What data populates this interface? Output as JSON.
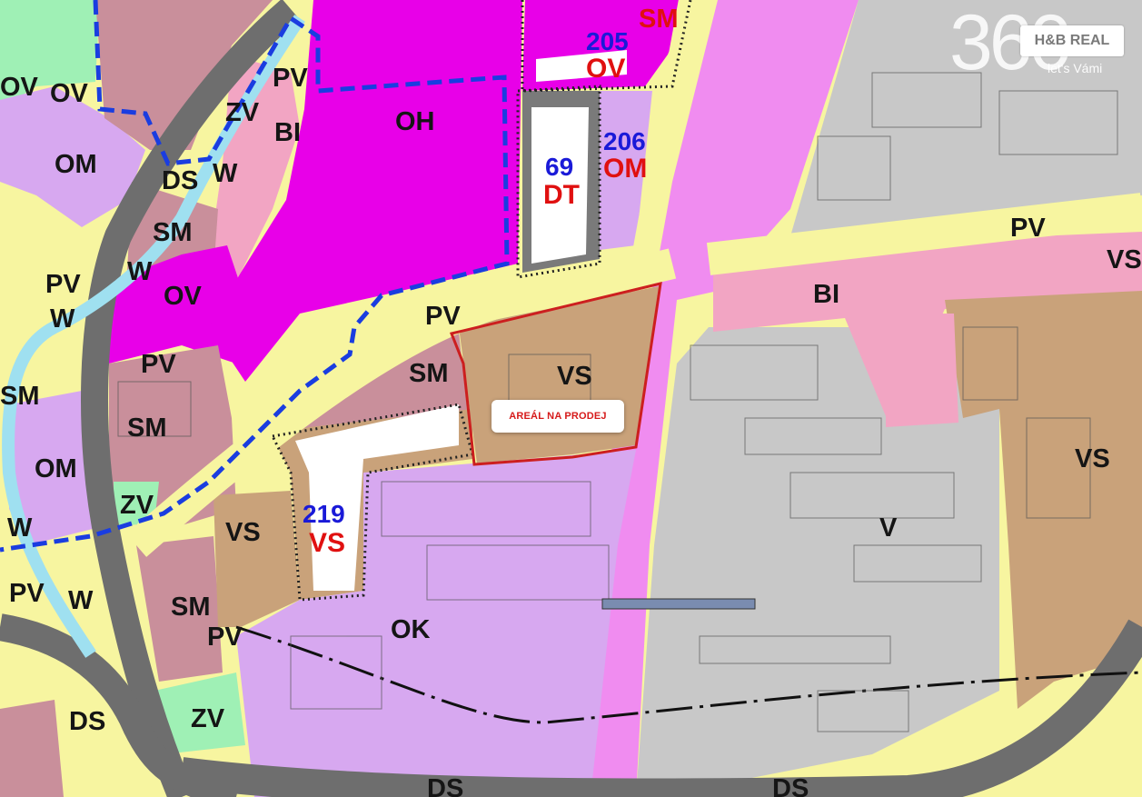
{
  "map": {
    "zones": [
      {
        "code": "OV",
        "color": "#e800e8"
      },
      {
        "code": "OH",
        "color": "#e800e8"
      },
      {
        "code": "OM",
        "color": "#d7a8f0"
      },
      {
        "code": "OK",
        "color": "#d7a8f0"
      },
      {
        "code": "SM",
        "color": "#c98f9b"
      },
      {
        "code": "BI",
        "color": "#f2a5c3"
      },
      {
        "code": "VS",
        "color": "#c9a27a"
      },
      {
        "code": "V",
        "color": "#c8c8c8"
      },
      {
        "code": "PV",
        "color": "#f7f5a0"
      },
      {
        "code": "ZV",
        "color": "#9ff0b5"
      },
      {
        "code": "DS",
        "color": "#6a6a6a"
      },
      {
        "code": "DT",
        "color": "#7a7a7a"
      },
      {
        "code": "W",
        "color": "#9fe0f0"
      }
    ],
    "labels": [
      "OV",
      "OV",
      "OV",
      "OH",
      "OM",
      "OM",
      "OK",
      "SM",
      "SM",
      "SM",
      "SM",
      "SM",
      "SM",
      "BI",
      "BI",
      "VS",
      "VS",
      "VS",
      "VS",
      "V",
      "PV",
      "PV",
      "PV",
      "PV",
      "PV",
      "PV",
      "PV",
      "ZV",
      "ZV",
      "ZV",
      "DS",
      "DS",
      "DS",
      "W",
      "W",
      "W",
      "W",
      "W",
      "DS"
    ],
    "development_areas": [
      {
        "number": "205",
        "code": "OV"
      },
      {
        "number": "206",
        "code": "OM"
      },
      {
        "number": "69",
        "code": "DT"
      },
      {
        "number": "219",
        "code": "VS"
      }
    ],
    "top_right_code": "SM",
    "callout": "AREÁL NA PRODEJ",
    "highlight_color": "#cc1f1f",
    "boundary_color": "#1a3de0"
  },
  "brand": {
    "logo_number": "360",
    "name": "H&B REAL",
    "tagline": "let's Vámi"
  }
}
